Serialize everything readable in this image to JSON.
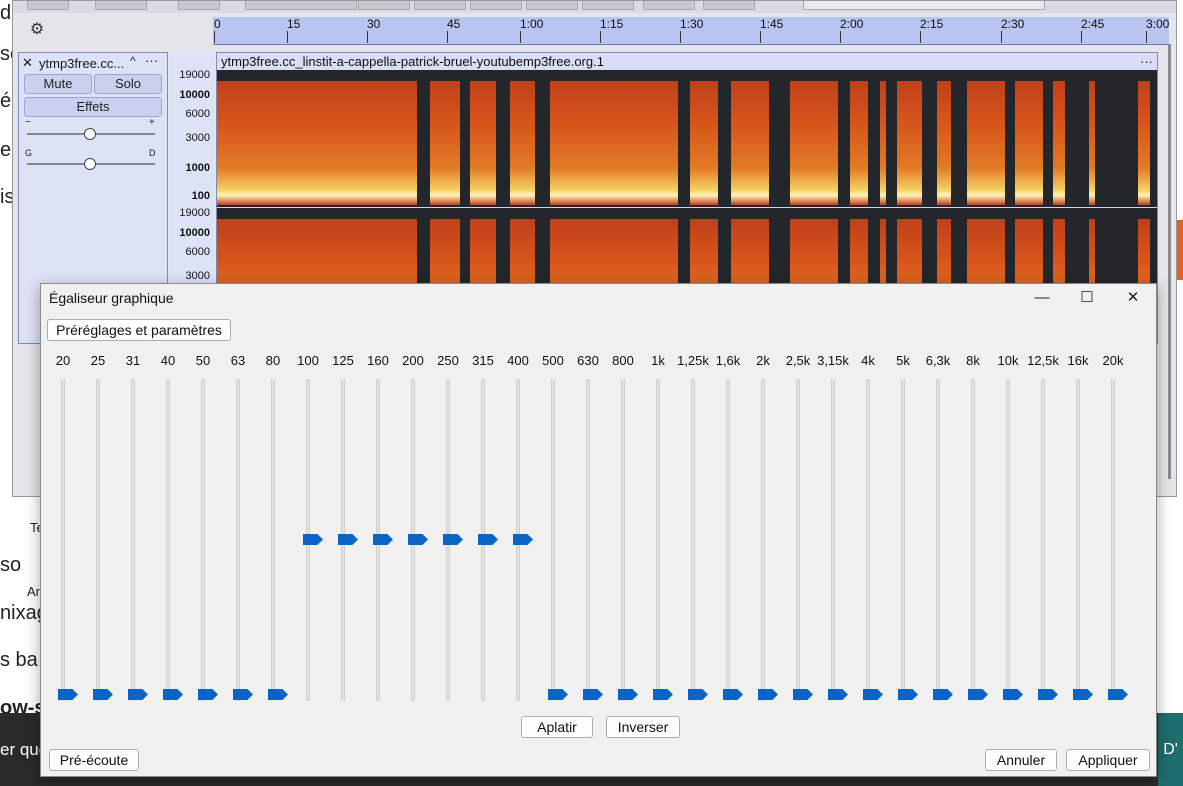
{
  "background": {
    "fragments": [
      "d",
      "se",
      "é",
      "e",
      "is",
      "so",
      "nixag",
      "s ba",
      "ow-s",
      "er que",
      "Te",
      "Ar",
      "D'"
    ]
  },
  "audacity": {
    "ruler_ticks": [
      "0",
      "15",
      "30",
      "45",
      "1:00",
      "1:15",
      "1:30",
      "1:45",
      "2:00",
      "2:15",
      "2:30",
      "2:45",
      "3:00"
    ],
    "track": {
      "name": "ytmp3free.cc...",
      "mute_label": "Mute",
      "solo_label": "Solo",
      "effects_label": "Effets",
      "gain_minus": "−",
      "gain_plus": "+",
      "pan_left": "G",
      "pan_right": "D"
    },
    "clip_name": "ytmp3free.cc_linstit-a-cappella-patrick-bruel-youtubemp3free.org.1",
    "scale_top": [
      "19000",
      "10000",
      "6000",
      "3000",
      "1000",
      "100"
    ],
    "scale_bottom": [
      "19000",
      "10000",
      "6000",
      "3000"
    ]
  },
  "dialog": {
    "title": "Égaliseur graphique",
    "presets_label": "Préréglages et paramètres",
    "bands": [
      "20",
      "25",
      "31",
      "40",
      "50",
      "63",
      "80",
      "100",
      "125",
      "160",
      "200",
      "250",
      "315",
      "400",
      "500",
      "630",
      "800",
      "1k",
      "1,25k",
      "1,6k",
      "2k",
      "2,5k",
      "3,15k",
      "4k",
      "5k",
      "6,3k",
      "8k",
      "10k",
      "12,5k",
      "16k",
      "20k"
    ],
    "band_levels": [
      0,
      0,
      0,
      0,
      0,
      0,
      0,
      0.5,
      0.5,
      0.5,
      0.5,
      0.5,
      0.5,
      0.5,
      0,
      0,
      0,
      0,
      0,
      0,
      0,
      0,
      0,
      0,
      0,
      0,
      0,
      0,
      0,
      0,
      0
    ],
    "flatten_label": "Aplatir",
    "invert_label": "Inverser",
    "preview_label": "Pré-écoute",
    "cancel_label": "Annuler",
    "apply_label": "Appliquer",
    "minimize_glyph": "—",
    "maximize_glyph": "☐",
    "close_glyph": "✕"
  }
}
